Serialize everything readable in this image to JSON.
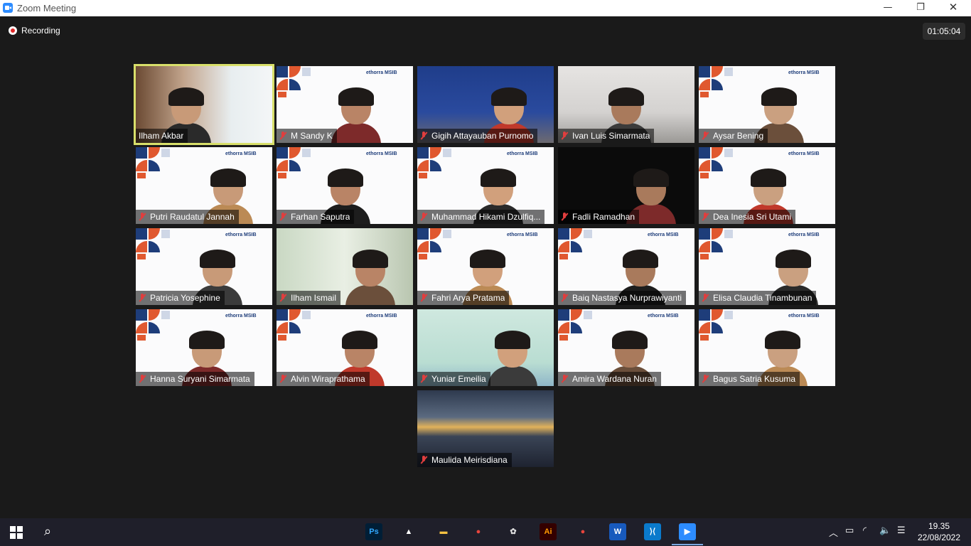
{
  "window": {
    "title": "Zoom Meeting",
    "minimize_icon": "—",
    "restore_icon": "❐",
    "close_icon": "✕"
  },
  "meeting": {
    "recording_label": "Recording",
    "elapsed": "01:05:04",
    "brand_text": "ethorra MSIB"
  },
  "participants": [
    {
      "name": "Ilham Akbar",
      "muted": false,
      "active": true,
      "bg": "photo-warm"
    },
    {
      "name": "M Sandy K",
      "muted": true,
      "bg": "virtual"
    },
    {
      "name": "Gigih Attayauban Purnomo",
      "muted": true,
      "bg": "blue-room"
    },
    {
      "name": "Ivan Luis Simarmata",
      "muted": true,
      "bg": "grey-room"
    },
    {
      "name": "Aysar Bening",
      "muted": true,
      "bg": "virtual"
    },
    {
      "name": "Putri Raudatul Jannah",
      "muted": true,
      "bg": "virtual"
    },
    {
      "name": "Farhan Saputra",
      "muted": true,
      "bg": "virtual"
    },
    {
      "name": "Muhammad Hikami Dzulfiq...",
      "muted": true,
      "bg": "virtual"
    },
    {
      "name": "Fadli Ramadhan",
      "muted": true,
      "bg": "dark"
    },
    {
      "name": "Dea Inesia Sri Utami",
      "muted": true,
      "bg": "virtual"
    },
    {
      "name": "Patricia Yosephine",
      "muted": true,
      "bg": "virtual"
    },
    {
      "name": "Ilham Ismail",
      "muted": true,
      "bg": "blur-green"
    },
    {
      "name": "Fahri Arya Pratama",
      "muted": true,
      "bg": "virtual"
    },
    {
      "name": "Baiq Nastasya Nurprawiyanti",
      "muted": true,
      "bg": "virtual"
    },
    {
      "name": "Elisa Claudia Tinambunan",
      "muted": true,
      "bg": "virtual"
    },
    {
      "name": "Hanna Suryani Simarmata",
      "muted": true,
      "bg": "virtual"
    },
    {
      "name": "Alvin Wiraprathama",
      "muted": true,
      "bg": "virtual"
    },
    {
      "name": "Yuniar Emeilia",
      "muted": true,
      "bg": "mint-room"
    },
    {
      "name": "Amira Wardana Nuran",
      "muted": true,
      "bg": "virtual"
    },
    {
      "name": "Bagus Satria Kusuma",
      "muted": true,
      "bg": "virtual"
    },
    {
      "name": "Maulida Meirisdiana",
      "muted": true,
      "bg": "sunset"
    }
  ],
  "taskbar": {
    "apps": [
      {
        "name": "photoshop",
        "label": "Ps",
        "color": "#31a8ff",
        "bg": "#001e36"
      },
      {
        "name": "app-2",
        "label": "▲",
        "color": "#ffffff",
        "bg": "transparent"
      },
      {
        "name": "file-explorer",
        "label": "▬",
        "color": "#f5c242",
        "bg": "transparent"
      },
      {
        "name": "chrome",
        "label": "●",
        "color": "#e8453c",
        "bg": "transparent"
      },
      {
        "name": "app-5",
        "label": "✿",
        "color": "#e0e0e0",
        "bg": "transparent"
      },
      {
        "name": "illustrator",
        "label": "Ai",
        "color": "#ff9a00",
        "bg": "#330000"
      },
      {
        "name": "chrome-2",
        "label": "●",
        "color": "#e8453c",
        "bg": "transparent"
      },
      {
        "name": "word",
        "label": "W",
        "color": "#ffffff",
        "bg": "#185abd"
      },
      {
        "name": "vscode",
        "label": "⟩⟨",
        "color": "#ffffff",
        "bg": "#0a7acc"
      },
      {
        "name": "zoom",
        "label": "▶",
        "color": "#ffffff",
        "bg": "#2d8cff"
      }
    ],
    "tray_icons": [
      "chevron-up",
      "battery",
      "wifi",
      "volume",
      "notification"
    ],
    "time": "19.35",
    "date": "22/08/2022"
  }
}
